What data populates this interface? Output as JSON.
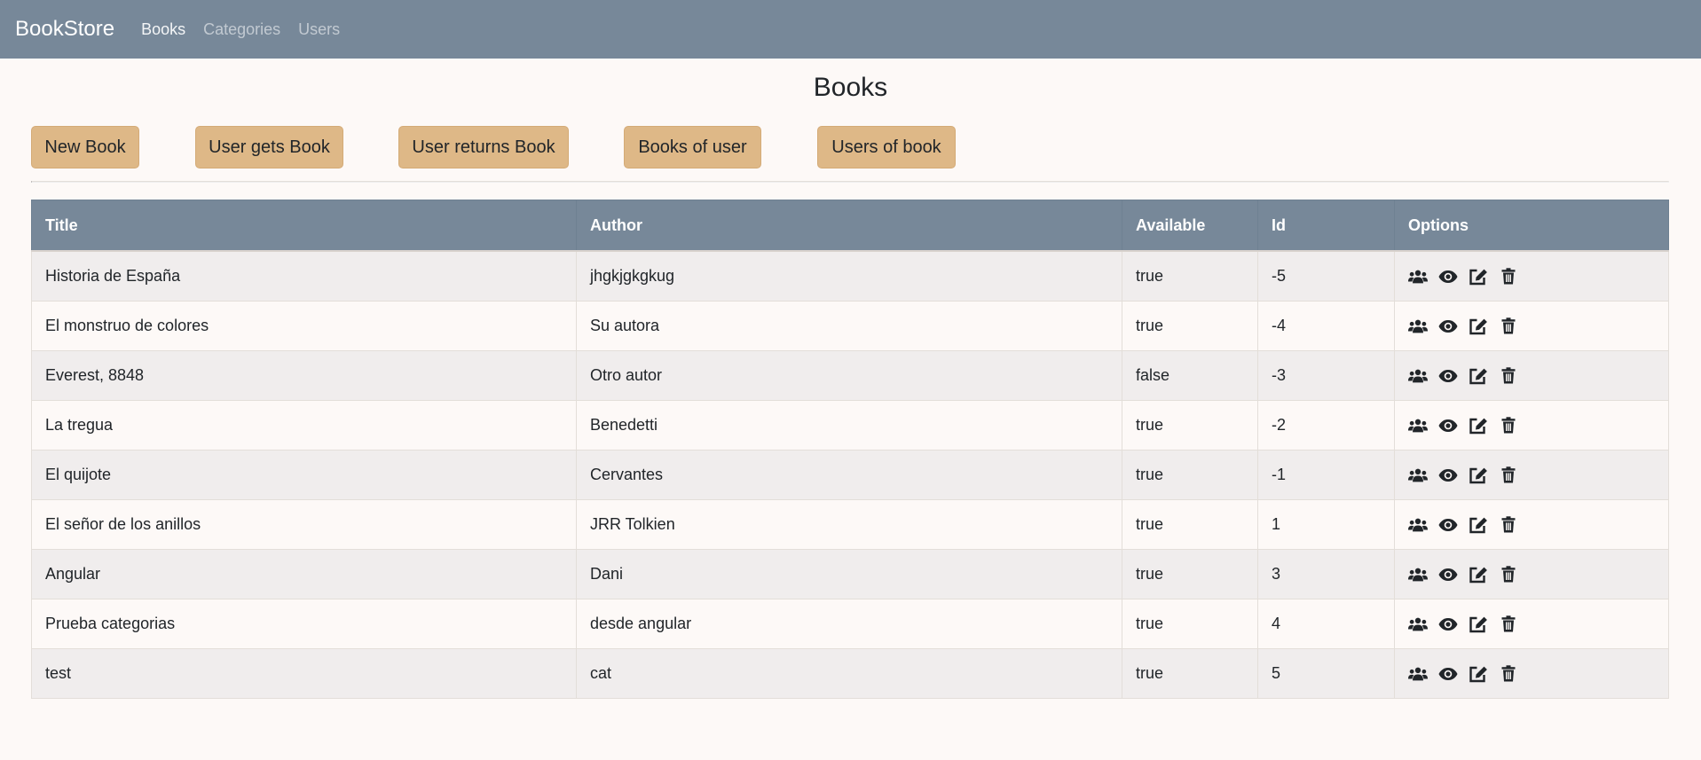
{
  "navbar": {
    "brand": "BookStore",
    "links": [
      {
        "label": "Books",
        "active": true
      },
      {
        "label": "Categories",
        "active": false
      },
      {
        "label": "Users",
        "active": false
      }
    ]
  },
  "page": {
    "title": "Books"
  },
  "actions": {
    "new_book": "New Book",
    "user_gets_book": "User gets Book",
    "user_returns_book": "User returns Book",
    "books_of_user": "Books of user",
    "users_of_book": "Users of book"
  },
  "table": {
    "headers": {
      "title": "Title",
      "author": "Author",
      "available": "Available",
      "id": "Id",
      "options": "Options"
    },
    "rows": [
      {
        "title": "Historia de España",
        "author": "jhgkjgkgkug",
        "available": "true",
        "id": "-5"
      },
      {
        "title": "El monstruo de colores",
        "author": "Su autora",
        "available": "true",
        "id": "-4"
      },
      {
        "title": "Everest, 8848",
        "author": "Otro autor",
        "available": "false",
        "id": "-3"
      },
      {
        "title": "La tregua",
        "author": "Benedetti",
        "available": "true",
        "id": "-2"
      },
      {
        "title": "El quijote",
        "author": "Cervantes",
        "available": "true",
        "id": "-1"
      },
      {
        "title": "El señor de los anillos",
        "author": "JRR Tolkien",
        "available": "true",
        "id": "1"
      },
      {
        "title": "Angular",
        "author": "Dani",
        "available": "true",
        "id": "3"
      },
      {
        "title": "Prueba categorias",
        "author": "desde angular",
        "available": "true",
        "id": "4"
      },
      {
        "title": "test",
        "author": "cat",
        "available": "true",
        "id": "5"
      }
    ],
    "row_icons": [
      "users-icon",
      "eye-icon",
      "edit-icon",
      "trash-icon"
    ]
  },
  "colors": {
    "navbar_bg": "#778899",
    "button_bg": "#deb887",
    "page_bg": "#fdf9f7",
    "stripe_bg": "#f0eded"
  }
}
